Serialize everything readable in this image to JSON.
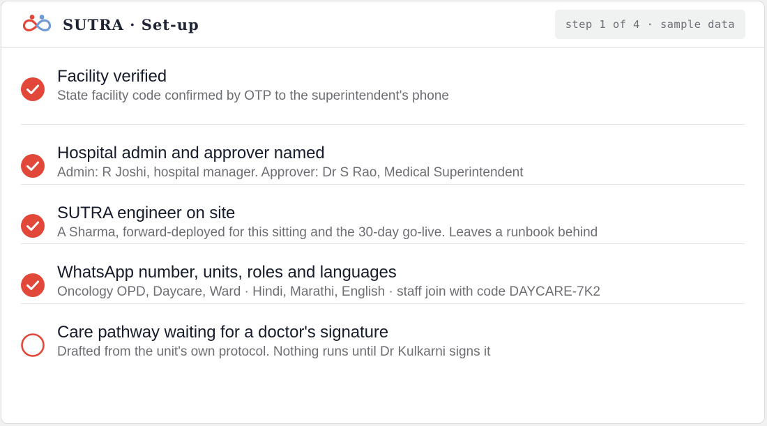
{
  "header": {
    "brand": "SUTRA · Set-up",
    "step_badge": "step 1 of 4 · sample data",
    "logo_icon": "infinity-people-logo-icon"
  },
  "colors": {
    "accent": "#e2483a",
    "title_text": "#161c2c",
    "sub_text": "#6c6e73",
    "logo_blue": "#6f9ad6"
  },
  "checklist": [
    {
      "status": "done",
      "icon": "check-circle-icon",
      "title": "Facility verified",
      "subtitle": "State facility code confirmed by OTP to the superintendent's phone"
    },
    {
      "status": "done",
      "icon": "check-circle-icon",
      "title": "Hospital admin and approver named",
      "subtitle": "Admin: R Joshi, hospital manager. Approver: Dr S Rao, Medical Superintendent"
    },
    {
      "status": "done",
      "icon": "check-circle-icon",
      "title": "SUTRA engineer on site",
      "subtitle": "A Sharma, forward-deployed for this sitting and the 30-day go-live. Leaves a runbook behind"
    },
    {
      "status": "done",
      "icon": "check-circle-icon",
      "title": "WhatsApp number, units, roles and languages",
      "subtitle": "Oncology OPD, Daycare, Ward · Hindi, Marathi, English · staff join with code DAYCARE-7K2"
    },
    {
      "status": "pending",
      "icon": "empty-circle-icon",
      "title": "Care pathway waiting for a doctor's signature",
      "subtitle": "Drafted from the unit's own protocol. Nothing runs until Dr Kulkarni signs it"
    }
  ]
}
